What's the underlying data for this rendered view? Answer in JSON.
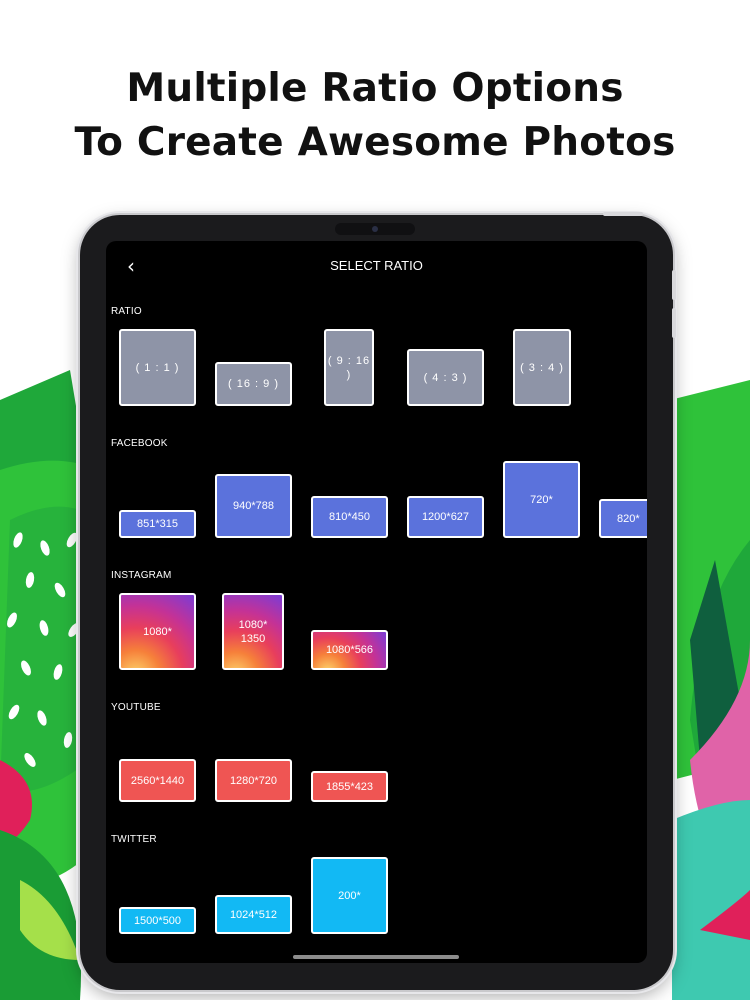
{
  "headline": {
    "line1": "Multiple Ratio Options",
    "line2": "To Create Awesome Photos"
  },
  "colors": {
    "screen_bg": "#000000",
    "ratio_tile": "#8e94a7",
    "facebook_tile": "#5b72dc",
    "youtube_tile": "#ef5553",
    "twitter_tile": "#12b9f4",
    "background_leaf_green": "#2fc23a",
    "background_leaf_pink": "#e0205a",
    "background_leaf_teal": "#3ec9b0"
  },
  "screen": {
    "back_icon": "chevron-left-icon",
    "back_glyph": "‹",
    "title": "SELECT RATIO",
    "sections": {
      "ratio": {
        "label": "RATIO",
        "tiles": [
          "( 1 : 1 )",
          "( 16 : 9 )",
          "( 9 : 16 )",
          "( 4 : 3 )",
          "( 3 : 4 )"
        ]
      },
      "facebook": {
        "label": "FACEBOOK",
        "tiles": [
          "851*315",
          "940*788",
          "810*450",
          "1200*627",
          "720*",
          "820*"
        ]
      },
      "instagram": {
        "label": "INSTAGRAM",
        "tiles": [
          "1080*",
          "1080*\n1350",
          "1080*566"
        ]
      },
      "youtube": {
        "label": "YOUTUBE",
        "tiles": [
          "2560*1440",
          "1280*720",
          "1855*423"
        ]
      },
      "twitter": {
        "label": "TWITTER",
        "tiles": [
          "1500*500",
          "1024*512",
          "200*"
        ]
      }
    }
  }
}
